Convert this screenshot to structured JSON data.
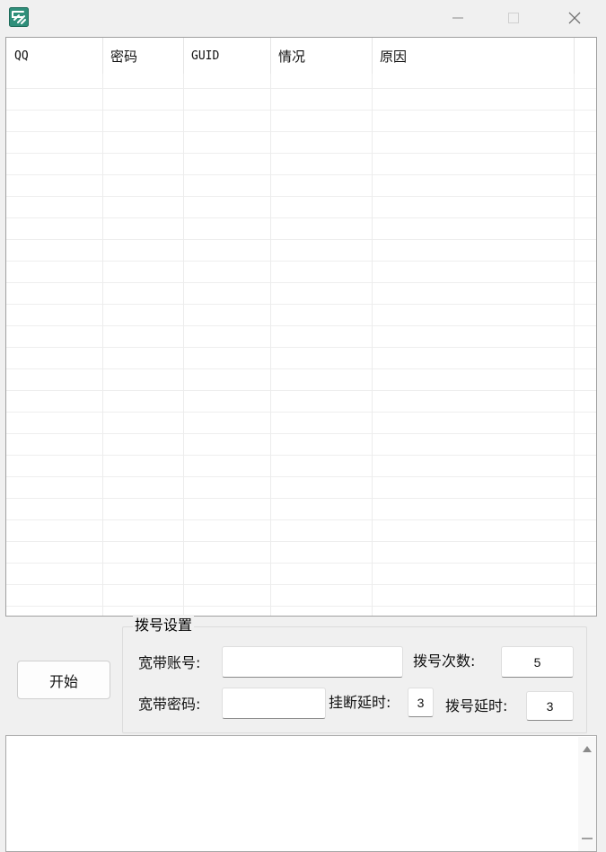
{
  "window": {
    "app_icon": "eyuyan-app-icon",
    "controls": [
      "minimize-icon",
      "maximize-icon",
      "close-icon"
    ]
  },
  "listview": {
    "columns": [
      "QQ",
      "密码",
      "GUID",
      "情况",
      "原因"
    ]
  },
  "start_button": {
    "label": "开始"
  },
  "dial_settings": {
    "title": "拨号设置",
    "broadband_account_label": "宽带账号:",
    "broadband_account_value": "",
    "broadband_password_label": "宽带密码:",
    "broadband_password_value": "",
    "dial_count_label": "拨号次数:",
    "dial_count_value": "5",
    "hangup_delay_label": "挂断延时:",
    "hangup_delay_value": "3",
    "dial_delay_label": "拨号延时:",
    "dial_delay_value": "3"
  },
  "log": {
    "text": ""
  },
  "colors": {
    "accent": "#2f8f7a",
    "window_bg": "#f0f0f0"
  }
}
